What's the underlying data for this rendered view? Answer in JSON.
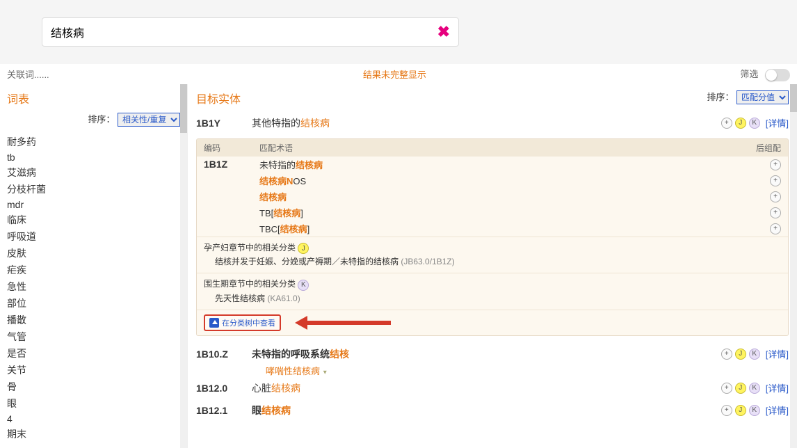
{
  "search": {
    "value": "结核病",
    "clear_icon": "close-icon"
  },
  "status": {
    "related": "关联词......",
    "center": "结果未完整显示",
    "filter": "筛选"
  },
  "left": {
    "title": "词表",
    "sort_label": "排序：",
    "sort_value": "相关性/重复",
    "words": [
      "耐多药",
      "tb",
      "艾滋病",
      "分枝杆菌",
      "mdr",
      "临床",
      "呼吸道",
      "皮肤",
      "疟疾",
      "急性",
      "部位",
      "播散",
      "气管",
      "是否",
      "关节",
      "骨",
      "眼",
      "4",
      "期末"
    ]
  },
  "right": {
    "title": "目标实体",
    "sort_label": "排序：",
    "sort_value": "匹配分值",
    "detail_label": "[详情]",
    "results": [
      {
        "code": "1B1Y",
        "prefix": "其他特指的",
        "highlight": "结核病",
        "actions": [
          "plus",
          "j",
          "k"
        ],
        "detail": true
      },
      {
        "code": "1B10.Z",
        "prefix": "未特指的呼吸系统",
        "highlight": "结核",
        "actions": [
          "plus",
          "j",
          "k"
        ],
        "detail": true,
        "bold": true,
        "sub_prefix": "哮喘性",
        "sub_highlight": "结核病"
      },
      {
        "code": "1B12.0",
        "prefix": "心脏",
        "highlight": "结核病",
        "actions": [
          "plus",
          "j",
          "k"
        ],
        "detail": true
      },
      {
        "code": "1B12.1",
        "prefix": "眼",
        "highlight": "结核病",
        "actions": [
          "plus",
          "j",
          "k"
        ],
        "detail": true,
        "bold": true
      }
    ],
    "panel": {
      "head": {
        "code": "编码",
        "term": "匹配术语",
        "post": "后组配"
      },
      "row_code": "1B1Z",
      "rows": [
        {
          "prefix": "未特指的",
          "highlight": "结核病"
        },
        {
          "prefix": "",
          "highlight": "结核病N",
          "suffix": "OS"
        },
        {
          "prefix": "",
          "highlight": "结核病"
        },
        {
          "prefix": "TB[",
          "highlight": "结核病",
          "suffix": "]"
        },
        {
          "prefix": "TBC[",
          "highlight": "结核病",
          "suffix": "]"
        }
      ],
      "sec1": {
        "title": "孕产妇章节中的相关分类",
        "badge": "J",
        "desc_main": "结核并发于妊娠、分娩或产褥期／未特指的结核病",
        "desc_paren": "(JB63.0/1B1Z)"
      },
      "sec2": {
        "title": "围生期章节中的相关分类",
        "badge": "K",
        "desc_main": "先天性结核病",
        "desc_paren": "(KA61.0)"
      },
      "tree_label": "在分类树中查看"
    }
  }
}
